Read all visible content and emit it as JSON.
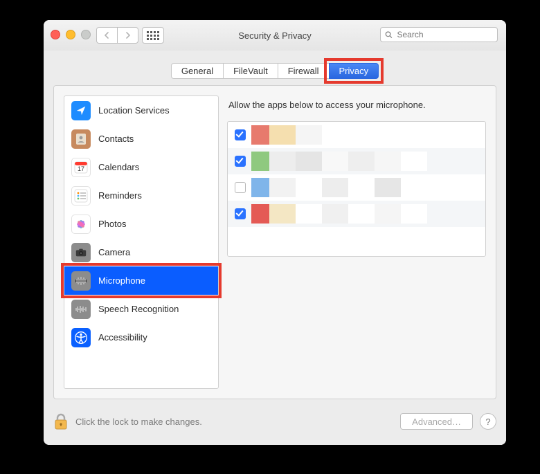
{
  "window": {
    "title": "Security & Privacy",
    "search_placeholder": "Search"
  },
  "tabs": [
    {
      "id": "general",
      "label": "General",
      "active": false
    },
    {
      "id": "filevault",
      "label": "FileVault",
      "active": false
    },
    {
      "id": "firewall",
      "label": "Firewall",
      "active": false
    },
    {
      "id": "privacy",
      "label": "Privacy",
      "active": true,
      "highlighted": true
    }
  ],
  "sidebar": {
    "items": [
      {
        "id": "location",
        "label": "Location Services",
        "icon": "location-arrow-icon",
        "bg": "#1e8cff"
      },
      {
        "id": "contacts",
        "label": "Contacts",
        "icon": "contacts-icon",
        "bg": "#c78a5e"
      },
      {
        "id": "calendars",
        "label": "Calendars",
        "icon": "calendar-icon",
        "bg": "#ffffff"
      },
      {
        "id": "reminders",
        "label": "Reminders",
        "icon": "reminders-icon",
        "bg": "#ffffff"
      },
      {
        "id": "photos",
        "label": "Photos",
        "icon": "photos-icon",
        "bg": "#ffffff"
      },
      {
        "id": "camera",
        "label": "Camera",
        "icon": "camera-icon",
        "bg": "#8c8c8c"
      },
      {
        "id": "microphone",
        "label": "Microphone",
        "icon": "microphone-icon",
        "bg": "#8c8c8c",
        "selected": true,
        "highlighted": true
      },
      {
        "id": "speech",
        "label": "Speech Recognition",
        "icon": "waveform-icon",
        "bg": "#8c8c8c"
      },
      {
        "id": "accessibility",
        "label": "Accessibility",
        "icon": "accessibility-icon",
        "bg": "#0a60ff"
      }
    ]
  },
  "main": {
    "description": "Allow the apps below to access your microphone.",
    "apps": [
      {
        "checked": true,
        "mosaic": [
          "#e77a6d",
          "#f5dfaf",
          "#f5f5f5",
          "#ffffff",
          "#ffffff",
          "#ffffff",
          "#ffffff"
        ]
      },
      {
        "checked": true,
        "mosaic": [
          "#8fc97f",
          "#ededed",
          "#e5e5e5",
          "#f8f8f8",
          "#eeeeee",
          "#f6f6f6",
          "#ffffff"
        ]
      },
      {
        "checked": false,
        "mosaic": [
          "#7fb5ea",
          "#f2f2f2",
          "#ffffff",
          "#ededed",
          "#ffffff",
          "#e6e6e6",
          "#ffffff"
        ]
      },
      {
        "checked": true,
        "mosaic": [
          "#e45a55",
          "#f4e7c4",
          "#ffffff",
          "#f0f0f0",
          "#ffffff",
          "#f5f5f5",
          "#ffffff"
        ]
      }
    ]
  },
  "footer": {
    "lock_text": "Click the lock to make changes.",
    "advanced_label": "Advanced…",
    "help_label": "?"
  }
}
